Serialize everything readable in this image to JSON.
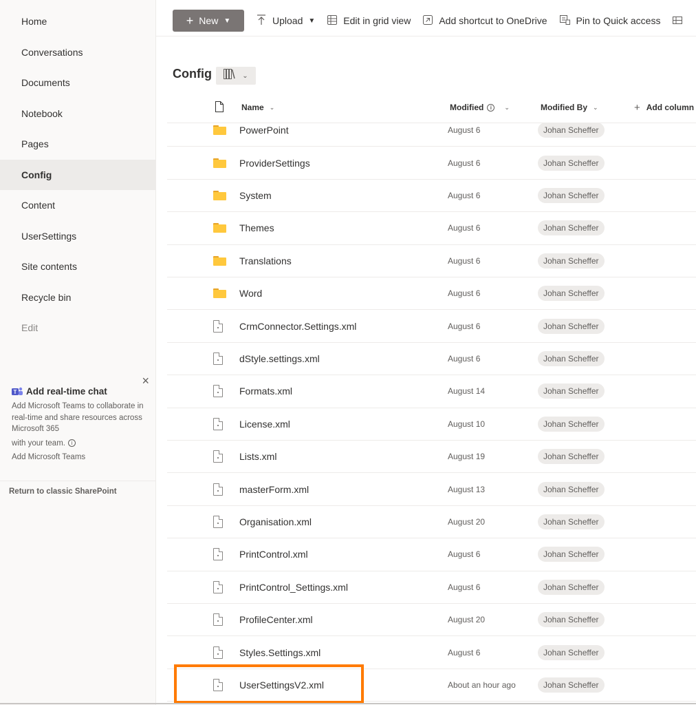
{
  "sidebar": {
    "items": [
      {
        "label": "Home",
        "active": false
      },
      {
        "label": "Conversations",
        "active": false
      },
      {
        "label": "Documents",
        "active": false
      },
      {
        "label": "Notebook",
        "active": false
      },
      {
        "label": "Pages",
        "active": false
      },
      {
        "label": "Config",
        "active": true
      },
      {
        "label": "Content",
        "active": false
      },
      {
        "label": "UserSettings",
        "active": false
      },
      {
        "label": "Site contents",
        "active": false
      },
      {
        "label": "Recycle bin",
        "active": false
      },
      {
        "label": "Edit",
        "active": false
      }
    ],
    "promo": {
      "close": "×",
      "title": "Add real-time chat",
      "text": "Add Microsoft Teams to collaborate in real-time and share resources across Microsoft 365",
      "text2": "with your team.",
      "link": "Add Microsoft Teams"
    },
    "classic_link": "Return to classic SharePoint"
  },
  "toolbar": {
    "new_label": "New",
    "upload_label": "Upload",
    "grid_label": "Edit in grid view",
    "shortcut_label": "Add shortcut to OneDrive",
    "pin_label": "Pin to Quick access"
  },
  "library": {
    "title": "Config"
  },
  "columns": {
    "name": "Name",
    "modified": "Modified",
    "modified_by": "Modified By",
    "add_column": "Add column"
  },
  "rows": [
    {
      "type": "folder",
      "name": "PowerPoint",
      "modified": "August 6",
      "by": "Johan Scheffer"
    },
    {
      "type": "folder",
      "name": "ProviderSettings",
      "modified": "August 6",
      "by": "Johan Scheffer"
    },
    {
      "type": "folder",
      "name": "System",
      "modified": "August 6",
      "by": "Johan Scheffer"
    },
    {
      "type": "folder",
      "name": "Themes",
      "modified": "August 6",
      "by": "Johan Scheffer"
    },
    {
      "type": "folder",
      "name": "Translations",
      "modified": "August 6",
      "by": "Johan Scheffer"
    },
    {
      "type": "folder",
      "name": "Word",
      "modified": "August 6",
      "by": "Johan Scheffer"
    },
    {
      "type": "file",
      "name": "CrmConnector.Settings.xml",
      "modified": "August 6",
      "by": "Johan Scheffer"
    },
    {
      "type": "file",
      "name": "dStyle.settings.xml",
      "modified": "August 6",
      "by": "Johan Scheffer"
    },
    {
      "type": "file",
      "name": "Formats.xml",
      "modified": "August 14",
      "by": "Johan Scheffer"
    },
    {
      "type": "file",
      "name": "License.xml",
      "modified": "August 10",
      "by": "Johan Scheffer"
    },
    {
      "type": "file",
      "name": "Lists.xml",
      "modified": "August 19",
      "by": "Johan Scheffer"
    },
    {
      "type": "file",
      "name": "masterForm.xml",
      "modified": "August 13",
      "by": "Johan Scheffer"
    },
    {
      "type": "file",
      "name": "Organisation.xml",
      "modified": "August 20",
      "by": "Johan Scheffer"
    },
    {
      "type": "file",
      "name": "PrintControl.xml",
      "modified": "August 6",
      "by": "Johan Scheffer"
    },
    {
      "type": "file",
      "name": "PrintControl_Settings.xml",
      "modified": "August 6",
      "by": "Johan Scheffer"
    },
    {
      "type": "file",
      "name": "ProfileCenter.xml",
      "modified": "August 20",
      "by": "Johan Scheffer"
    },
    {
      "type": "file",
      "name": "Styles.Settings.xml",
      "modified": "August 6",
      "by": "Johan Scheffer"
    },
    {
      "type": "file",
      "name": "UserSettingsV2.xml",
      "modified": "About an hour ago",
      "by": "Johan Scheffer"
    }
  ],
  "colors": {
    "highlight": "#ff7a00",
    "folder": "#ffc83d",
    "new_button": "#7a7574"
  }
}
